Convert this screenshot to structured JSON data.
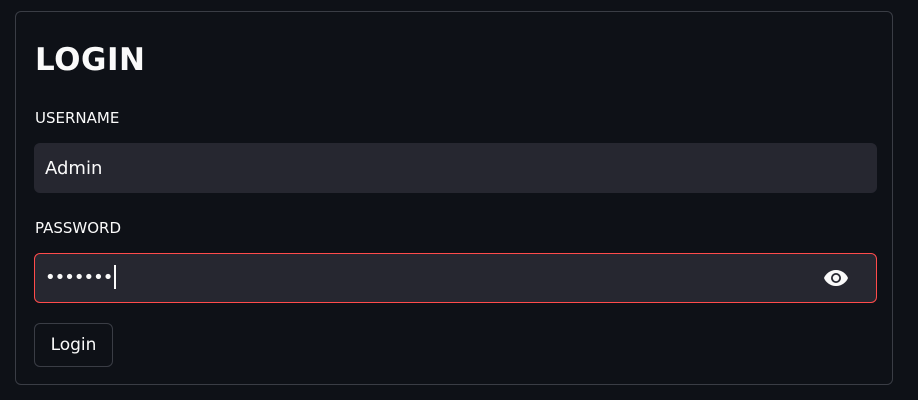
{
  "form": {
    "title": "LOGIN",
    "username": {
      "label": "USERNAME",
      "value": "Admin"
    },
    "password": {
      "label": "PASSWORD",
      "masked_value": "•••••••",
      "toggle_icon": "eye-icon"
    },
    "submit_label": "Login"
  },
  "colors": {
    "background": "#0e1117",
    "input_background": "#262730",
    "border": "#3a3d45",
    "focus_border": "#ff4b4b",
    "text": "#fafafa"
  }
}
